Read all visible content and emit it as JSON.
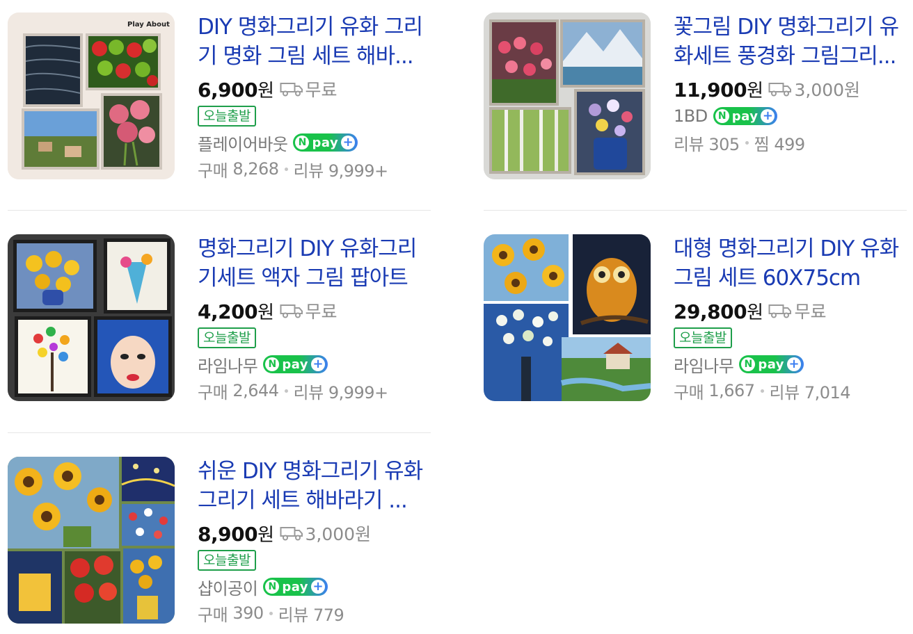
{
  "products": [
    {
      "title": "DIY 명화그리기 유화 그리기 명화 그림 세트 해바...",
      "price": "6,900",
      "currency": "원",
      "shipping": "무료",
      "badge": "오늘출발",
      "seller": "플레이어바웃",
      "npay": "pay",
      "stats": {
        "label1": "구매",
        "value1": "8,268",
        "label2": "리뷰",
        "value2": "9,999+"
      },
      "thumb_text": "Play About"
    },
    {
      "title": "꽃그림 DIY 명화그리기 유화세트 풍경화 그림그리...",
      "price": "11,900",
      "currency": "원",
      "shipping": "3,000원",
      "seller": "1BD",
      "npay": "pay",
      "stats": {
        "label1": "리뷰",
        "value1": "305",
        "label2": "찜",
        "value2": "499"
      }
    },
    {
      "title": "명화그리기 DIY 유화그리기세트 액자 그림 팝아트",
      "price": "4,200",
      "currency": "원",
      "shipping": "무료",
      "badge": "오늘출발",
      "seller": "라임나무",
      "npay": "pay",
      "stats": {
        "label1": "구매",
        "value1": "2,644",
        "label2": "리뷰",
        "value2": "9,999+"
      }
    },
    {
      "title": "대형 명화그리기 DIY 유화 그림 세트 60X75cm",
      "price": "29,800",
      "currency": "원",
      "shipping": "무료",
      "badge": "오늘출발",
      "seller": "라임나무",
      "npay": "pay",
      "stats": {
        "label1": "구매",
        "value1": "1,667",
        "label2": "리뷰",
        "value2": "7,014"
      }
    },
    {
      "title": "쉬운 DIY 명화그리기 유화 그리기 세트 해바라기 ...",
      "price": "8,900",
      "currency": "원",
      "shipping": "3,000원",
      "badge": "오늘출발",
      "seller": "샵이공이",
      "npay": "pay",
      "stats": {
        "label1": "구매",
        "value1": "390",
        "label2": "리뷰",
        "value2": "779"
      }
    }
  ],
  "colors": {
    "title_link": "#1a3bb3",
    "badge_green": "#1e9e4a",
    "npay_green": "#19c24a",
    "npay_blue": "#3d7ff2",
    "muted_text": "#8c8c8c"
  },
  "icons": [
    "truck-icon",
    "npay-n-icon",
    "npay-plus-icon"
  ]
}
